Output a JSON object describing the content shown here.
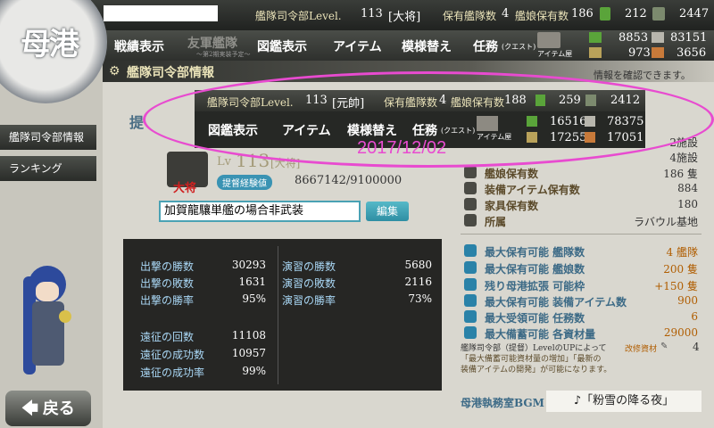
{
  "header": {
    "logo_text": "母港",
    "hq_level_label": "艦隊司令部Level.",
    "hq_level": "113",
    "rank_bracket": "[大将]",
    "fleet_count_label": "保有艦隊数",
    "fleet_count": "4",
    "ship_count_label": "艦娘保有数",
    "ship_count": "186",
    "bucket": "212",
    "devmat": "2447",
    "fuel": "8853",
    "steel": "83151",
    "ammo": "973",
    "bauxite": "3656"
  },
  "nav": {
    "items": [
      "戦績表示",
      "友軍艦隊",
      "図鑑表示",
      "アイテム",
      "模様替え",
      "任務"
    ],
    "sub_note": "～第2期実装予定～",
    "quest_suffix": "(クエスト)",
    "shop_label": "アイテム屋"
  },
  "title": {
    "label": "艦隊司令部情報",
    "hint": "情報を確認できます。"
  },
  "sidebar": {
    "items": [
      "艦隊司令部情報",
      "ランキング"
    ]
  },
  "popup": {
    "hq_level_label": "艦隊司令部Level.",
    "hq_level": "113",
    "rank_bracket": "[元帥]",
    "fleet_count_label": "保有艦隊数",
    "fleet_count": "4",
    "ship_count_label": "艦娘保有数",
    "ship_count": "188",
    "bucket": "259",
    "devmat": "2412",
    "fuel": "16516",
    "steel": "78375",
    "ammo": "17255",
    "bauxite": "17051",
    "nav": [
      "図鑑表示",
      "アイテム",
      "模様替え",
      "任務"
    ],
    "quest_suffix": "(クエスト)",
    "shop_label": "アイテム屋",
    "date": "2017/12/02"
  },
  "profile": {
    "title_partial": "提",
    "level_label": "Lv",
    "level": "113",
    "rank": "[大将]",
    "rank_badge": "大将",
    "exp_label": "提督経験値",
    "exp": "8667142/9100000",
    "comment": "加賀龍驤単艦の場合非武装",
    "edit_button": "編集"
  },
  "stats": {
    "left": [
      {
        "label": "出撃の勝数",
        "value": "30293"
      },
      {
        "label": "出撃の敗数",
        "value": "1631"
      },
      {
        "label": "出撃の勝率",
        "value": "95%"
      },
      {
        "label": "遠征の回数",
        "value": "11108"
      },
      {
        "label": "遠征の成功数",
        "value": "10957"
      },
      {
        "label": "遠征の成功率",
        "value": "99%"
      }
    ],
    "right": [
      {
        "label": "演習の勝数",
        "value": "5680"
      },
      {
        "label": "演習の敗数",
        "value": "2116"
      },
      {
        "label": "演習の勝率",
        "value": "73%"
      }
    ]
  },
  "facility": {
    "row1_value": "2施設",
    "row2_value": "4施設",
    "ship_count_label": "艦娘保有数",
    "ship_count": "186 隻",
    "equip_label": "装備アイテム保有数",
    "equip": "884",
    "furniture_label": "家具保有数",
    "furniture": "180",
    "affiliation_label": "所属",
    "affiliation": "ラバウル基地"
  },
  "limits": [
    {
      "label": "最大保有可能 艦隊数",
      "value": "4 艦隊"
    },
    {
      "label": "最大保有可能 艦娘数",
      "value": "200 隻"
    },
    {
      "label": "残り母港拡張 可能枠",
      "value": "+150 隻"
    },
    {
      "label": "最大保有可能 装備アイテム数",
      "value": "900"
    },
    {
      "label": "最大受領可能 任務数",
      "value": "6"
    },
    {
      "label": "最大備蓄可能 各資材量",
      "value": "29000"
    }
  ],
  "note": {
    "line1": "艦隊司令部（提督）LevelのUPによって",
    "line2": "「最大備蓄可能資材量の増加」「最新の",
    "line3": "装備アイテムの開発」が可能になります。",
    "improve_label": "改修資材",
    "improve_value": "4"
  },
  "bgm": {
    "label": "母港執務室BGM",
    "value": "♪「粉雪の降る夜」"
  },
  "back_button": "戻る",
  "colors": {
    "highlight": "#e84bd0",
    "accent": "#4aa2b4"
  }
}
